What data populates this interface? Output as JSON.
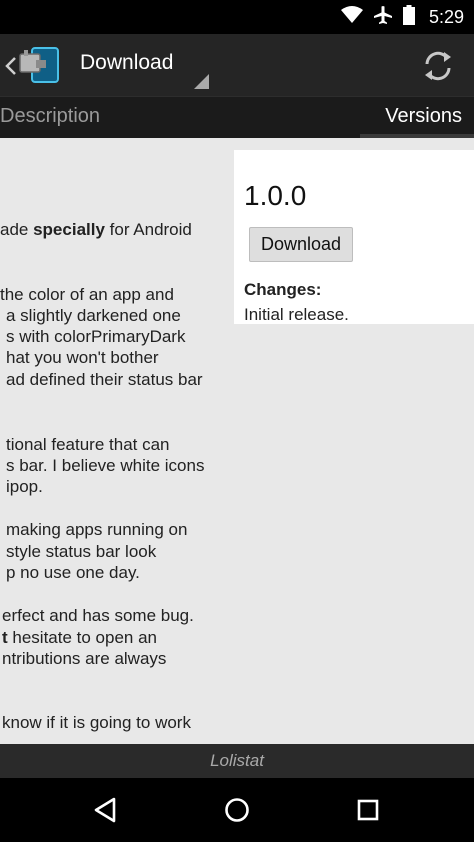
{
  "status_bar": {
    "time": "5:29",
    "icons": [
      "wifi-icon",
      "airplane-icon",
      "battery-icon"
    ]
  },
  "app_bar": {
    "title": "Download",
    "icons": [
      "back-chevron-icon",
      "app-logo-icon",
      "spinner-dropdown-icon",
      "refresh-icon"
    ]
  },
  "tabs": [
    {
      "label": "Description",
      "selected": false
    },
    {
      "label": "Versions",
      "selected": true
    }
  ],
  "description": {
    "lines": [
      {
        "pre": "ade ",
        "bold": "specially",
        "post": " for Android"
      },
      {
        "pre": " the color of an app and",
        "bold": "",
        "post": ""
      },
      {
        "pre": "a slightly darkened one",
        "bold": "",
        "post": ""
      },
      {
        "pre": "s with colorPrimaryDark",
        "bold": "",
        "post": ""
      },
      {
        "pre": "hat you won't bother",
        "bold": "",
        "post": ""
      },
      {
        "pre": "ad defined their status bar",
        "bold": "",
        "post": ""
      },
      {
        "pre": "tional feature that can",
        "bold": "",
        "post": ""
      },
      {
        "pre": "s bar. I believe white icons",
        "bold": "",
        "post": ""
      },
      {
        "pre": "ipop.",
        "bold": "",
        "post": ""
      },
      {
        "pre": "making apps running on",
        "bold": "",
        "post": ""
      },
      {
        "pre": "style status bar look",
        "bold": "",
        "post": ""
      },
      {
        "pre": "p no use one day.",
        "bold": "",
        "post": ""
      },
      {
        "pre": "erfect and has some bug.",
        "bold": "",
        "post": ""
      },
      {
        "pre": "",
        "bold": "t",
        "post": " hesitate to open an"
      },
      {
        "pre": "ntributions are always",
        "bold": "",
        "post": ""
      },
      {
        "pre": "know if it is going to work",
        "bold": "",
        "post": ""
      }
    ]
  },
  "version_card": {
    "version": "1.0.0",
    "download_label": "Download",
    "changes_label": "Changes:",
    "changes_text": "Initial release."
  },
  "footer": {
    "text": "Lolistat"
  },
  "nav_bar": {
    "icons": [
      "back-icon",
      "home-icon",
      "recents-icon"
    ]
  },
  "colors": {
    "app_bar": "#252525",
    "tab_bar": "#1b1b1b",
    "content_bg": "#e8e8e8",
    "card_bg": "#ffffff",
    "footer_bg": "#2a2a2a"
  }
}
